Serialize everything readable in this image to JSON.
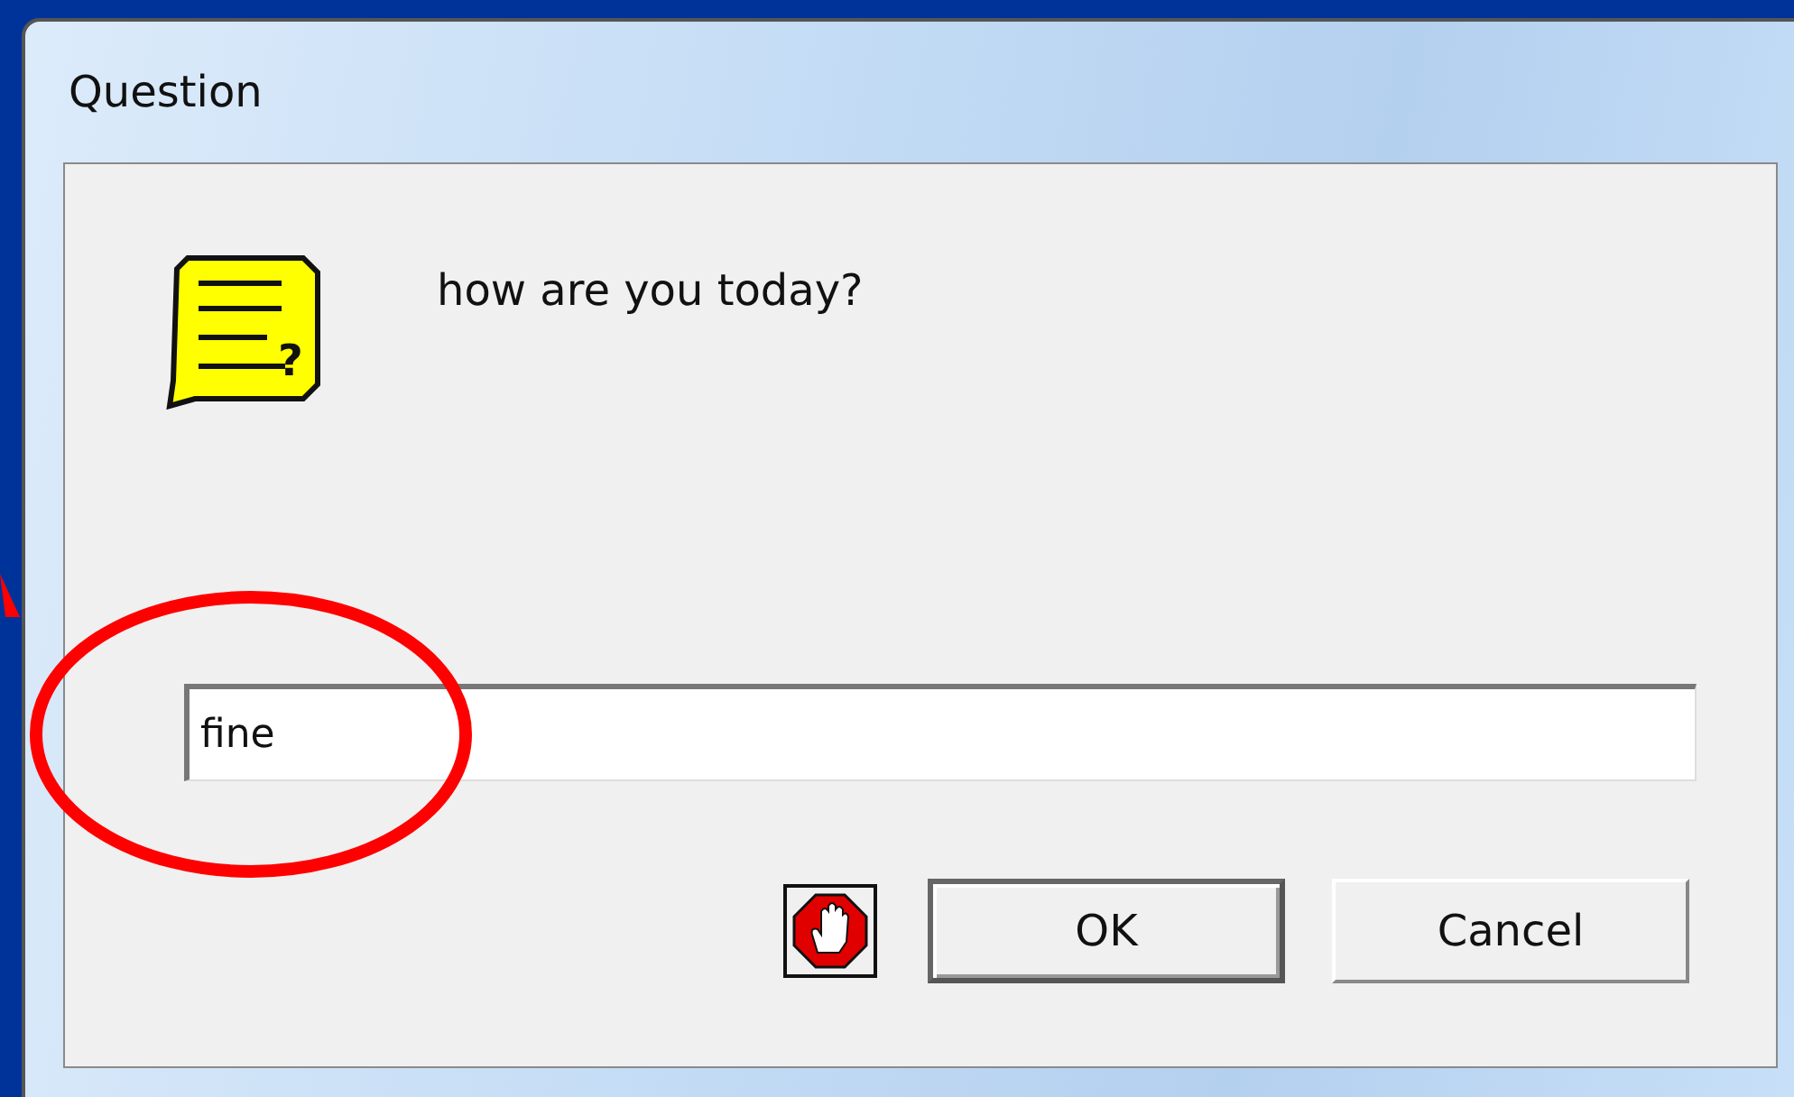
{
  "window": {
    "title": "Question"
  },
  "message_icon": {
    "glyph": "?"
  },
  "message": "how are you today?",
  "answer": {
    "value": "fine"
  },
  "buttons": [
    {
      "label": "OK",
      "default": true
    },
    {
      "label": "Cancel",
      "default": false
    }
  ]
}
